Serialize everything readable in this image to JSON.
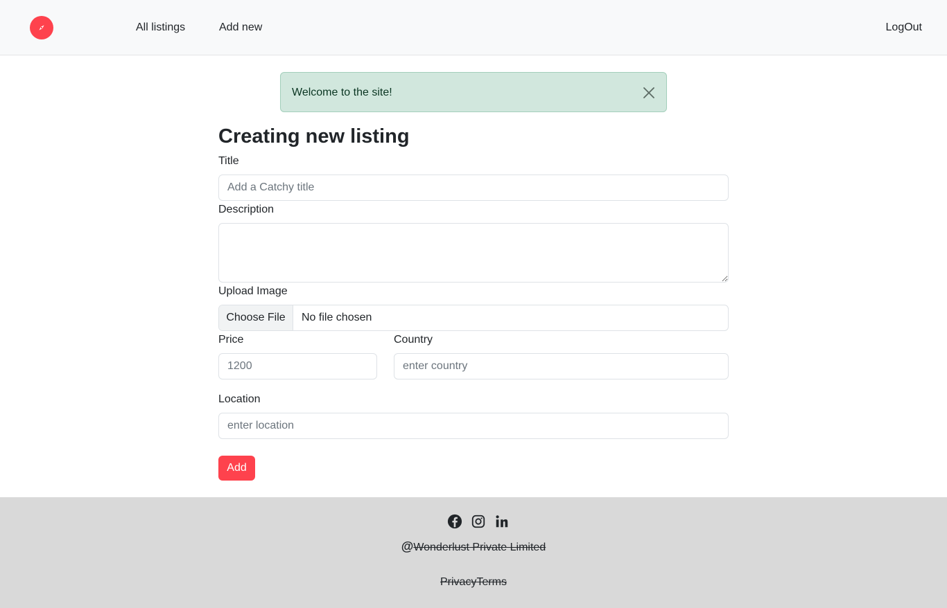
{
  "navbar": {
    "brand_icon": "compass-icon",
    "brand_color": "#fe424d",
    "links": {
      "all_listings": "All listings",
      "add_new": "Add new",
      "logout": "LogOut"
    }
  },
  "alert": {
    "message": "Welcome to the site!",
    "close_icon": "close-icon",
    "background": "#d1e7dd"
  },
  "form": {
    "heading": "Creating new listing",
    "title_label": "Title",
    "title_placeholder": "Add a Catchy title",
    "title_value": "",
    "description_label": "Description",
    "description_value": "",
    "image_label": "Upload Image",
    "file_button": "Choose File",
    "file_status": "No file chosen",
    "price_label": "Price",
    "price_placeholder": "1200",
    "country_label": "Country",
    "country_placeholder": "enter country",
    "location_label": "Location",
    "location_placeholder": "enter location",
    "submit_label": "Add",
    "submit_color": "#fe424d"
  },
  "footer": {
    "social_icons": [
      "facebook-icon",
      "instagram-icon",
      "linkedin-icon"
    ],
    "copyright_symbol": "@",
    "company": "Wonderlust Private Limited",
    "privacy": "Privacy",
    "terms": "Terms",
    "background": "#d9d9d9"
  }
}
